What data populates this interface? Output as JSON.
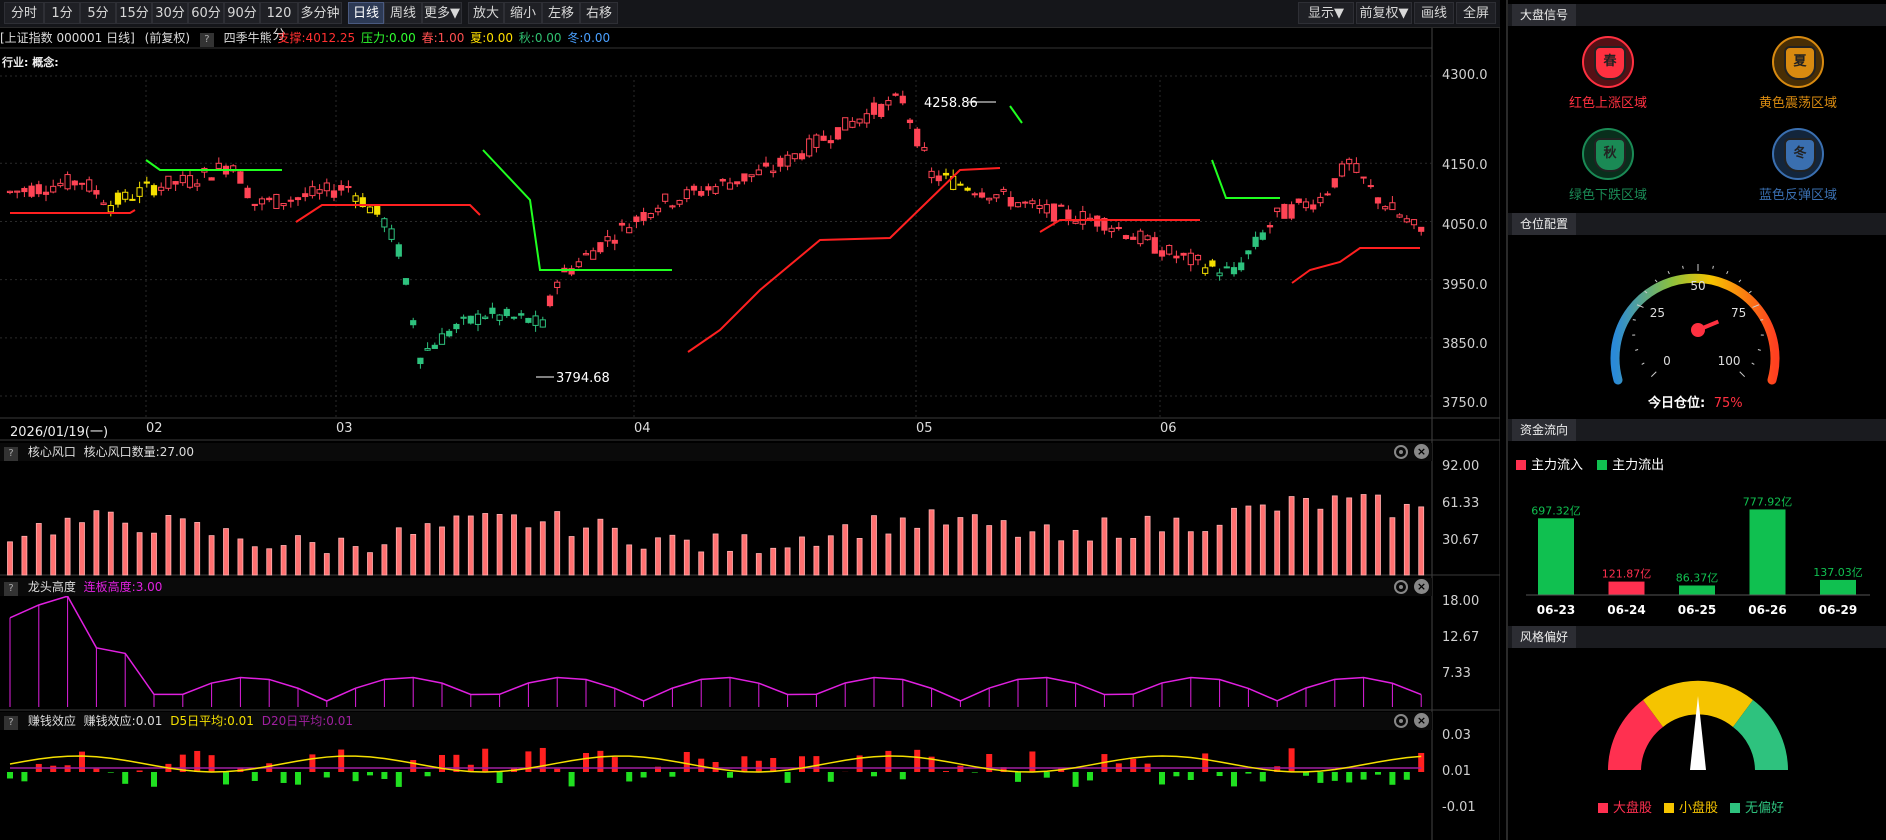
{
  "toolbar": {
    "buttons": [
      "分时",
      "1分",
      "5分",
      "15分",
      "30分",
      "60分",
      "90分",
      "120分",
      "多分钟",
      "日线",
      "周线",
      "更多▼",
      "放大",
      "缩小",
      "左移",
      "右移"
    ],
    "active": "日线",
    "right_buttons": [
      "显示▼",
      "前复权▼",
      "画线",
      "全屏"
    ]
  },
  "titlebar": {
    "symbol": "[上证指数 000001 日线]",
    "adjust": "(前复权)",
    "help": "?",
    "indicator": "四季牛熊",
    "support": "支撑:4012.25",
    "pressure": "压力:0.00",
    "spring": "春:1.00",
    "summer": "夏:0.00",
    "autumn": "秋:0.00",
    "winter": "冬:0.00"
  },
  "industry_label": "行业: 概念:",
  "price_axis": [
    "4300.0",
    "4150.0",
    "4050.0",
    "3950.0",
    "3850.0",
    "3750.0"
  ],
  "annotations": {
    "high": "4258.86",
    "low": "3794.68"
  },
  "date_bar": {
    "current": "2026/01/19(一)",
    "months": [
      "02",
      "03",
      "04",
      "05",
      "06"
    ]
  },
  "panels": {
    "core": {
      "help": "?",
      "name": "核心风口",
      "value": "核心风口数量:27.00",
      "axis": [
        "92.00",
        "61.33",
        "30.67"
      ]
    },
    "leader": {
      "help": "?",
      "name": "龙头高度",
      "value": "连板高度:3.00",
      "axis": [
        "18.00",
        "12.67",
        "7.33"
      ]
    },
    "profit": {
      "help": "?",
      "name": "赚钱效应",
      "value": "赚钱效应:0.01",
      "d5": "D5日平均:0.01",
      "d20": "D20日平均:0.01",
      "axis": [
        "0.03",
        "0.01",
        "-0.01"
      ]
    }
  },
  "right": {
    "signal": {
      "title": "大盘信号",
      "items": [
        {
          "glyph": "春",
          "label": "红色上涨区域",
          "color": "#ff3040"
        },
        {
          "glyph": "夏",
          "label": "黄色震荡区域",
          "color": "#d88a10"
        },
        {
          "glyph": "秋",
          "label": "绿色下跌区域",
          "color": "#1a8a55"
        },
        {
          "glyph": "冬",
          "label": "蓝色反弹区域",
          "color": "#3a6fb0"
        }
      ]
    },
    "position": {
      "title": "仓位配置",
      "ticks": [
        "0",
        "25",
        "50",
        "75",
        "100"
      ],
      "label": "今日仓位:",
      "value": "75%",
      "level": 75
    },
    "flow": {
      "title": "资金流向",
      "legend_in": "主力流入",
      "legend_out": "主力流出",
      "days": [
        {
          "date": "06-23",
          "value": "697.32亿",
          "amount": 697.32,
          "dir": "out"
        },
        {
          "date": "06-24",
          "value": "121.87亿",
          "amount": 121.87,
          "dir": "in"
        },
        {
          "date": "06-25",
          "value": "86.37亿",
          "amount": 86.37,
          "dir": "out"
        },
        {
          "date": "06-26",
          "value": "777.92亿",
          "amount": 777.92,
          "dir": "out"
        },
        {
          "date": "06-29",
          "value": "137.03亿",
          "amount": 137.03,
          "dir": "out"
        }
      ]
    },
    "style": {
      "title": "风格偏好",
      "legend": [
        {
          "label": "大盘股",
          "color": "#ff3050"
        },
        {
          "label": "小盘股",
          "color": "#f5c400"
        },
        {
          "label": "无偏好",
          "color": "#2ec27e"
        }
      ]
    }
  },
  "colors": {
    "up": "#ff4455",
    "down": "#2ec27e",
    "yellow": "#f5e000",
    "magenta": "#e020e0",
    "support": "#ff2020",
    "pressure": "#20ff20"
  }
}
